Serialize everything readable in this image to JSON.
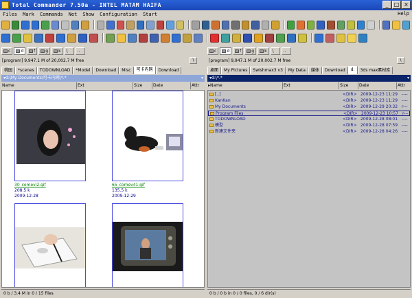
{
  "window": {
    "title": "Total Commander 7.50a - INTEL MATAM HAIFA"
  },
  "menu": [
    "Files",
    "Mark",
    "Commands",
    "Net",
    "Show",
    "Configuration",
    "Start"
  ],
  "menu_help": "Help",
  "toolbar1_colors": [
    "#e0b040",
    "#3a8a3a",
    "#2f6fd0",
    "#2f6fd0",
    "#4aa04a",
    "#6a8ad0",
    "#c0c0c0",
    "#5080c0",
    "#d0a040",
    "#b0b0b0",
    "#4070d0",
    "#d05050",
    "#c0a060",
    "#3070c0",
    "#80a0d0",
    "#c04040",
    "#60a0e0",
    "#d0c060",
    "#a0a0a0",
    "#306090",
    "#d07030",
    "#5070b0",
    "#707070",
    "#c09030",
    "#4060a0",
    "#b0b0b0",
    "#d0a030",
    "#40a040",
    "#e07030",
    "#80b040",
    "#3060c0",
    "#a05030",
    "#60a060",
    "#c0c040",
    "#3080d0",
    "#d0d0d0",
    "#5070c0",
    "#f0c040",
    "#50a0d0"
  ],
  "toolbar2_colors": [
    "#2f6fd0",
    "#4aa04a",
    "#e0c040",
    "#3a70c0",
    "#c04040",
    "#2f6fd0",
    "#d0a040",
    "#3060c0",
    "#c05050",
    "#70a050",
    "#f0c040",
    "#5080c0",
    "#b04040",
    "#4060b0",
    "#d08030",
    "#3070d0",
    "#c0a040",
    "#6080c0",
    "#e03030",
    "#40a0a0",
    "#d0b040",
    "#3050b0",
    "#e0a020",
    "#a04040",
    "#50a050",
    "#3070c0",
    "#d0c040",
    "#2f6fd0",
    "#c06060",
    "#e0c040",
    "#f0d050",
    "#3080c0"
  ],
  "left": {
    "drives": [
      "c",
      "d",
      "f",
      "g",
      "k",
      "\\",
      ".."
    ],
    "active_drive": "d",
    "free": "[program]  9,947.1 M of 20,002.7 M free",
    "up": "\\",
    "tabs": [
      "桃园",
      "*scenes",
      "TODOWNLOAD",
      "*Model",
      "Download",
      "Misc",
      "可卡内网",
      "Download"
    ],
    "active_tab": 6,
    "path": "▾d:\\My Documents\\可卡内网\\*.*",
    "path_hist": "▾",
    "columns": {
      "name": "Name",
      "ext": "Ext",
      "size": "Size",
      "date": "Date",
      "attr": "Attr"
    },
    "thumbnails": [
      {
        "name": "30_comevi2.gif",
        "size": "208.5 k",
        "date": "2009-12-28"
      },
      {
        "name": "65_comev41.gif",
        "size": "135.5 k",
        "date": "2009-12-29"
      },
      {
        "name": "",
        "size": "",
        "date": ""
      },
      {
        "name": "",
        "size": "",
        "date": ""
      }
    ],
    "status": "0 b / 3.4 M in 0 / 15 files"
  },
  "right": {
    "drives": [
      "c",
      "d",
      "f",
      "g",
      "k",
      "\\",
      ".."
    ],
    "active_drive": "d",
    "free": "[program]  9,947.1 M of 20,002.7 M free",
    "up": "\\",
    "tabs": [
      "桌面",
      "My Pictures",
      "Swishmax3 v3",
      "My Data",
      "媒体",
      "Download",
      "d:",
      "3ds max素材库"
    ],
    "active_tab": 6,
    "path": "▾d:\\*.*",
    "path_hist": "▾",
    "columns": {
      "name": "▸Name",
      "ext": "Ext",
      "size": "Size",
      "date": "Date",
      "attr": "Attr"
    },
    "rows": [
      {
        "name": "[..]",
        "size": "<DIR>",
        "date": "2009-12-23 11:29",
        "attr": "----"
      },
      {
        "name": "KanKan",
        "size": "<DIR>",
        "date": "2009-12-23 11:29",
        "attr": "----"
      },
      {
        "name": "My Documents",
        "size": "<DIR>",
        "date": "2009-12-29 20:32",
        "attr": "r---"
      },
      {
        "name": "Program Files",
        "size": "<DIR>",
        "date": "2009-12-23 10:57",
        "attr": "r---"
      },
      {
        "name": "TODOWNLOAD",
        "size": "<DIR>",
        "date": "2009-12-28 08:01",
        "attr": "----"
      },
      {
        "name": "模型",
        "size": "<DIR>",
        "date": "2009-12-28 07:59",
        "attr": "----"
      },
      {
        "name": "新建文件夹",
        "size": "<DIR>",
        "date": "2009-12-28 04:26",
        "attr": "----"
      }
    ],
    "cursor_row": 3,
    "status": "0 b / 0 b in 0 / 0 files, 0 / 6 dir(s)"
  }
}
